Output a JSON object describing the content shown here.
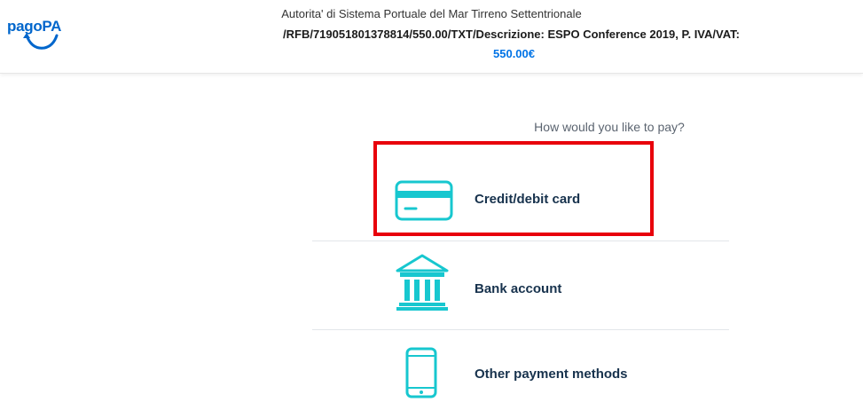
{
  "header": {
    "logo_text": "pagoPA",
    "organization": "Autorita' di Sistema Portuale del Mar Tirreno Settentrionale",
    "description": "/RFB/719051801378814/550.00/TXT/Descrizione: ESPO Conference 2019, P. IVA/VAT:",
    "amount": "550.00€"
  },
  "main": {
    "question": "How would you like to pay?",
    "methods": [
      {
        "label": "Credit/debit card",
        "icon": "credit-card-icon"
      },
      {
        "label": "Bank account",
        "icon": "bank-icon"
      },
      {
        "label": "Other payment methods",
        "icon": "smartphone-icon"
      }
    ]
  },
  "colors": {
    "accent": "#0073e6",
    "icon": "#17c7cf",
    "highlight": "#e8000b"
  }
}
